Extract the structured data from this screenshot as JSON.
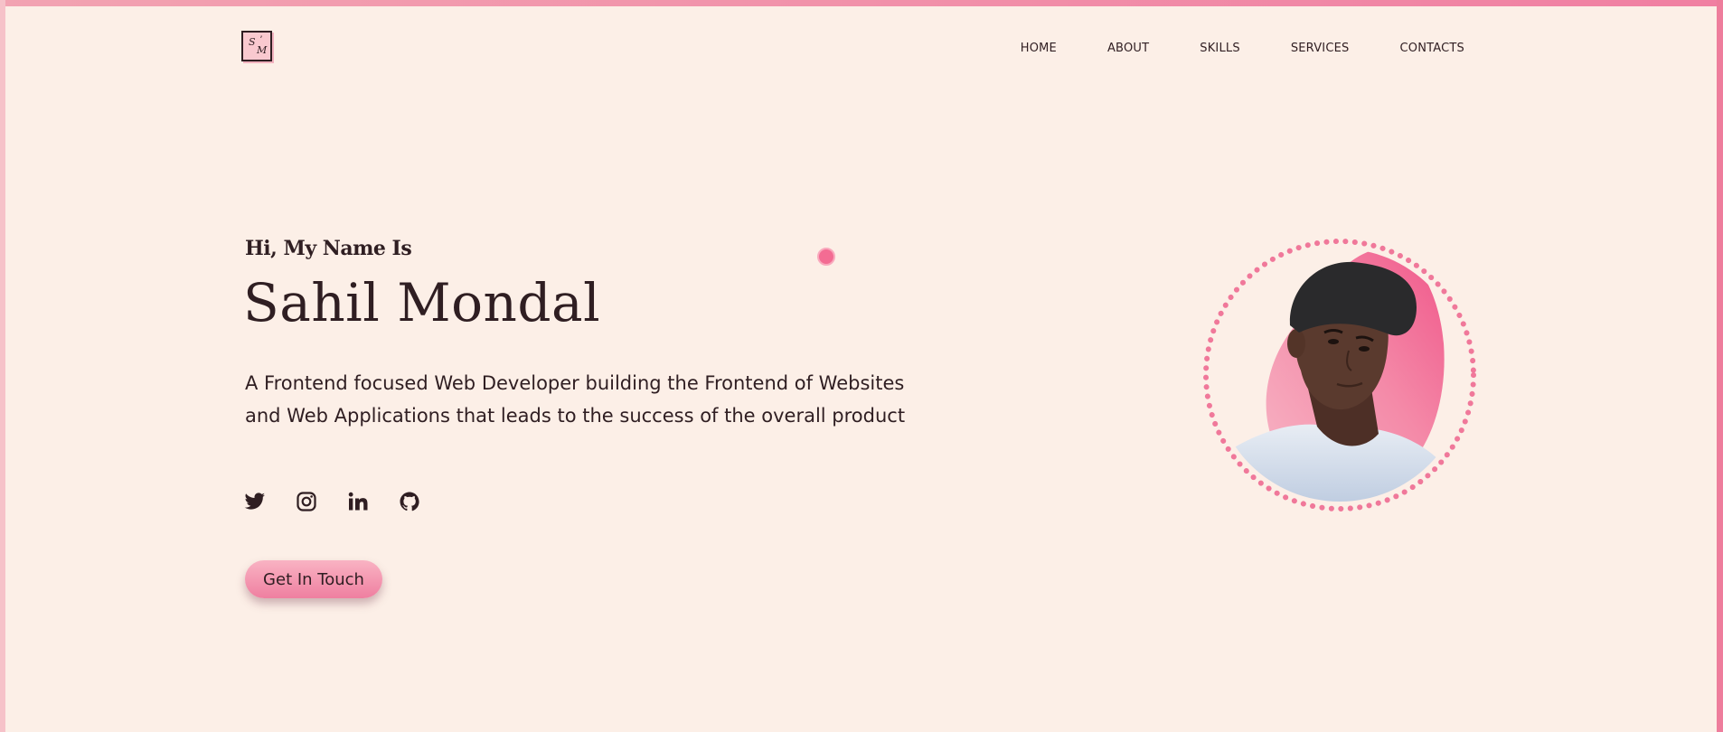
{
  "header": {
    "logo": {
      "line1": "S",
      "accent": "ʼ",
      "line2": "M"
    },
    "nav": [
      {
        "label": "HOME"
      },
      {
        "label": "ABOUT"
      },
      {
        "label": "SKILLS"
      },
      {
        "label": "SERVICES"
      },
      {
        "label": "CONTACTS"
      }
    ]
  },
  "hero": {
    "greeting": "Hi, My Name Is",
    "name": "Sahil Mondal",
    "bio": "A Frontend focused Web Developer building the Frontend of Websites and Web Applications that leads to the success of the overall product",
    "socials": [
      {
        "icon": "twitter-icon"
      },
      {
        "icon": "instagram-icon"
      },
      {
        "icon": "linkedin-icon"
      },
      {
        "icon": "github-icon"
      }
    ],
    "cta_label": "Get In Touch"
  },
  "colors": {
    "background": "#fcefe7",
    "accent_pink": "#f36c93",
    "text": "#2f1e22"
  }
}
